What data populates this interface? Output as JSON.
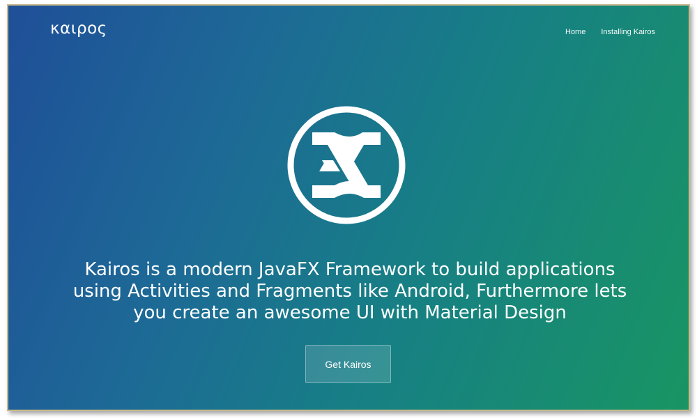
{
  "brand": {
    "logo_text": "καιρος"
  },
  "nav": {
    "items": [
      {
        "label": "Home"
      },
      {
        "label": "Installing Kairos"
      }
    ]
  },
  "hero": {
    "emblem_icon": "kairos-fx-logo-icon",
    "tagline_lines": [
      "Kairos is a modern JavaFX Framework to build applications",
      "using Activities and Fragments like Android, Furthermore lets",
      "you create an awesome UI with Material Design"
    ],
    "cta_label": "Get Kairos"
  },
  "colors": {
    "gradient_start": "#1f4f98",
    "gradient_mid": "#177f85",
    "gradient_end": "#189563",
    "text": "#ffffff"
  }
}
